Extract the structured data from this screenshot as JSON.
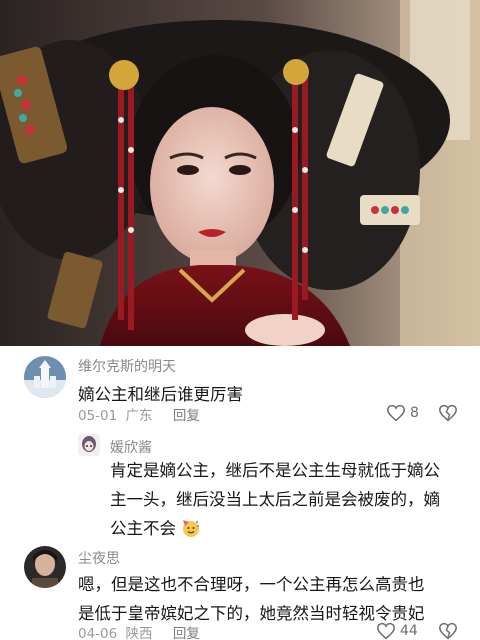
{
  "comments": [
    {
      "username": "维尔克斯的明天",
      "text": "嫡公主和继后谁更厉害",
      "date": "05-01",
      "location": "广东",
      "reply_label": "回复",
      "like_count": "8",
      "avatar": "snow-castle-avatar"
    },
    {
      "username": "媛欣酱",
      "text_lines": [
        "肯定是嫡公主，继后不是公主生母就低于嫡公",
        "主一头，继后没当上太后之前是会被废的，嫡",
        "公主不会"
      ],
      "emoji": "party-face-emoji",
      "avatar": "anime-girl-avatar",
      "is_reply": true
    },
    {
      "username": "尘夜思",
      "text_lines": [
        "嗯，但是这也不合理呀，一个公主再怎么高贵也",
        "是低于皇帝嫔妃之下的，她竟然当时轻视令贵妃"
      ],
      "date": "04-06",
      "location": "陕西",
      "reply_label": "回复",
      "like_count": "44",
      "avatar": "dark-portrait-avatar"
    }
  ],
  "colors": {
    "text_primary": "#161616",
    "text_secondary": "#8a8a8a",
    "icon": "#6e6e6e"
  }
}
